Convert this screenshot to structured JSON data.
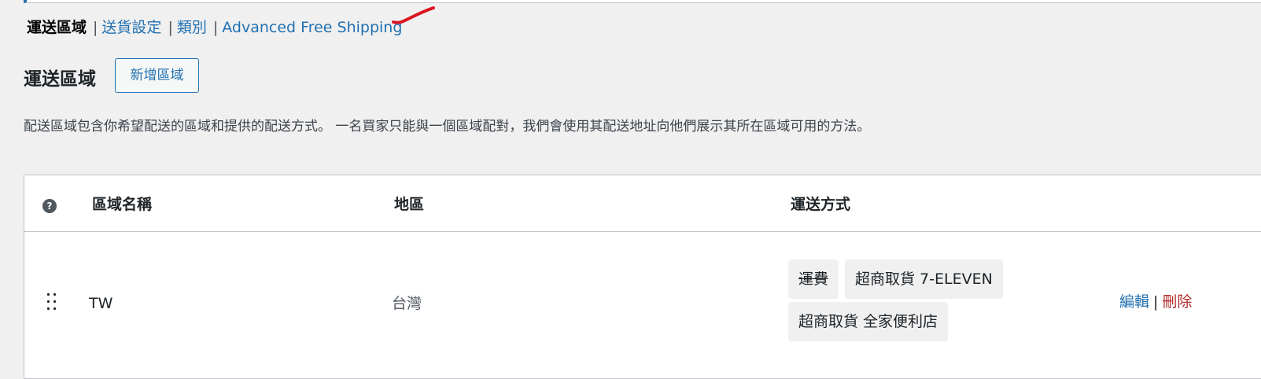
{
  "nav": {
    "current": "運送區域",
    "links": [
      "送貨設定",
      "類別",
      "Advanced Free Shipping"
    ],
    "separator": "|"
  },
  "heading": {
    "title": "運送區域",
    "add_button": "新增區域"
  },
  "description": "配送區域包含你希望配送的區域和提供的配送方式。 一名買家只能與一個區域配對，我們會使用其配送地址向他們展示其所在區域可用的方法。",
  "table": {
    "help_icon_glyph": "?",
    "columns": {
      "name": "區域名稱",
      "region": "地區",
      "methods": "運送方式"
    },
    "rows": [
      {
        "name": "TW",
        "region": "台灣",
        "methods": [
          "運費",
          "超商取貨 7-ELEVEN",
          "超商取貨 全家便利店"
        ],
        "actions": {
          "edit": "編輯",
          "delete": "刪除",
          "separator": "|"
        }
      }
    ]
  },
  "colors": {
    "link": "#2271b1",
    "delete": "#b32d2e",
    "annotation": "#d9141e",
    "background": "#f0f0f1"
  }
}
